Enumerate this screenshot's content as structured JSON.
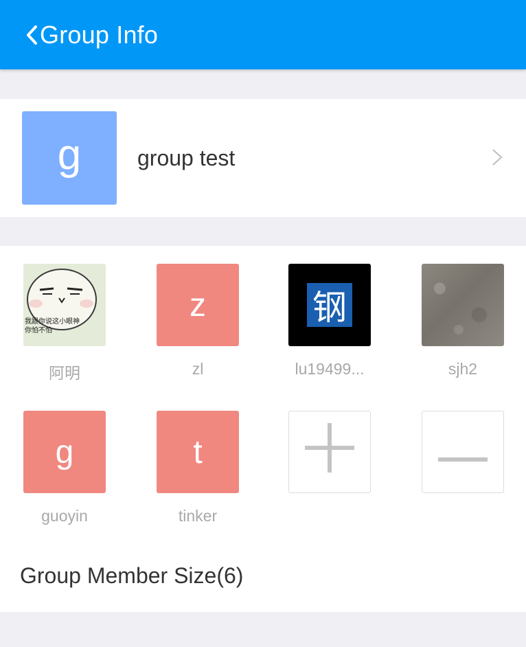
{
  "header": {
    "title": "Group Info",
    "back_icon": "chevron-left-icon",
    "bg_color": "#0097f7"
  },
  "group": {
    "avatar_letter": "g",
    "avatar_color": "#7fb0ff",
    "name": "group test",
    "chevron_icon": "chevron-right-icon"
  },
  "members": [
    {
      "name": "阿明",
      "avatar_type": "sticker-image",
      "sticker_text_line1": "我跟你说这小眼神",
      "sticker_text_line2": "你怕不怕"
    },
    {
      "name": "zl",
      "avatar_letter": "z",
      "avatar_color": "#f08880"
    },
    {
      "name": "lu19499...",
      "avatar_char": "钢",
      "avatar_color": "#000000",
      "char_bg": "#1a5fb0"
    },
    {
      "name": "sjh2",
      "avatar_type": "concrete-texture-image"
    },
    {
      "name": "guoyin",
      "avatar_letter": "g",
      "avatar_color": "#f08880"
    },
    {
      "name": "tinker",
      "avatar_letter": "t",
      "avatar_color": "#f08880"
    }
  ],
  "actions": {
    "add_icon": "plus-icon",
    "remove_icon": "minus-icon"
  },
  "member_size_label": "Group Member Size(6)"
}
